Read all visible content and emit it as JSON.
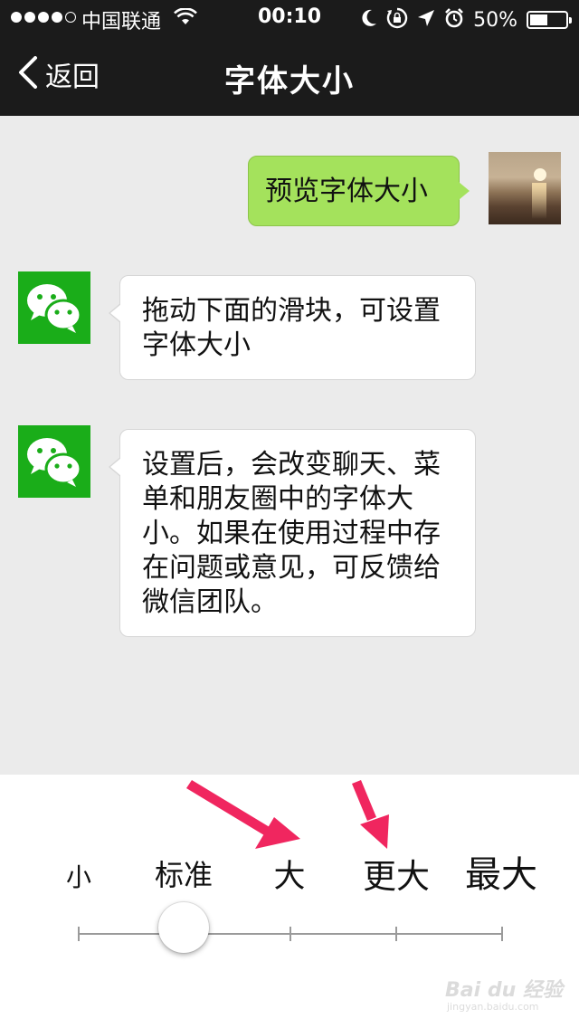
{
  "status_bar": {
    "carrier": "中国联通",
    "time": "00:10",
    "battery_percent": "50%",
    "battery_level": 0.5,
    "signal_bars_filled": 4,
    "icons": [
      "signal-dots-icon",
      "wifi-icon",
      "moon-icon",
      "rotation-lock-icon",
      "location-arrow-icon",
      "alarm-clock-icon",
      "battery-icon"
    ]
  },
  "nav": {
    "back_label": "返回",
    "title": "字体大小"
  },
  "chat": {
    "messages": [
      {
        "from": "me",
        "text": "预览字体大小"
      },
      {
        "from": "wechat",
        "lines": [
          "拖动下面的滑块，可设置",
          "字体大小"
        ]
      },
      {
        "from": "wechat",
        "lines": [
          "设置后，会改变聊天、菜",
          "单和朋友圈中的字体大",
          "小。如果在使用过程中存",
          "在问题或意见，可反馈给",
          "微信团队。"
        ]
      }
    ]
  },
  "font_size_slider": {
    "labels": [
      "小",
      "标准",
      "大",
      "更大",
      "最大"
    ],
    "selected_index": 1,
    "selected_label": "标准"
  },
  "colors": {
    "nav_bg": "#1b1b1b",
    "chat_bg": "#ebebeb",
    "my_bubble": "#a4e25c",
    "wechat_green": "#1aad19",
    "annotation_arrow": "#f0265f"
  },
  "watermark": {
    "text": "Bai du 经验",
    "url": "jingyan.baidu.com"
  }
}
